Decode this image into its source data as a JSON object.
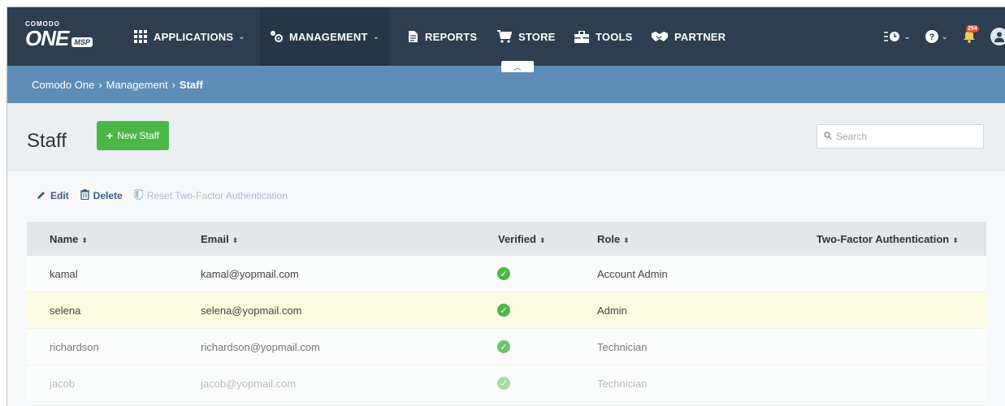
{
  "nav": {
    "logo_small": "COMODO",
    "logo_big": "ONE",
    "logo_badge": "MSP",
    "items": [
      {
        "label": "APPLICATIONS",
        "icon": "grid-icon",
        "has_dropdown": true
      },
      {
        "label": "MANAGEMENT",
        "icon": "management-icon",
        "has_dropdown": true,
        "active": true
      },
      {
        "label": "REPORTS",
        "icon": "reports-icon"
      },
      {
        "label": "STORE",
        "icon": "cart-icon"
      },
      {
        "label": "TOOLS",
        "icon": "toolbox-icon"
      },
      {
        "label": "PARTNER",
        "icon": "handshake-icon"
      }
    ],
    "notification_count": "254"
  },
  "breadcrumb": {
    "root": "Comodo One",
    "parent": "Management",
    "current": "Staff"
  },
  "page": {
    "title": "Staff",
    "new_button": "New Staff",
    "search_placeholder": "Search"
  },
  "actions": {
    "edit": "Edit",
    "delete": "Delete",
    "reset_2fa": "Reset Two-Factor Authentication"
  },
  "table": {
    "headers": {
      "name": "Name",
      "email": "Email",
      "verified": "Verified",
      "role": "Role",
      "tfa": "Two-Factor Authentication"
    },
    "rows": [
      {
        "name": "kamal",
        "email": "kamal@yopmail.com",
        "verified": true,
        "role": "Account Admin",
        "tfa": ""
      },
      {
        "name": "selena",
        "email": "selena@yopmail.com",
        "verified": true,
        "role": "Admin",
        "tfa": ""
      },
      {
        "name": "richardson",
        "email": "richardson@yopmail.com",
        "verified": true,
        "role": "Technician",
        "tfa": ""
      },
      {
        "name": "jacob",
        "email": "jacob@yopmail.com",
        "verified": true,
        "role": "Technician",
        "tfa": ""
      }
    ]
  },
  "colors": {
    "nav_bg": "#2c3e50",
    "breadcrumb_bg": "#5e8eb8",
    "accent_green": "#4cb748",
    "highlight_row": "#fbfbdf"
  }
}
